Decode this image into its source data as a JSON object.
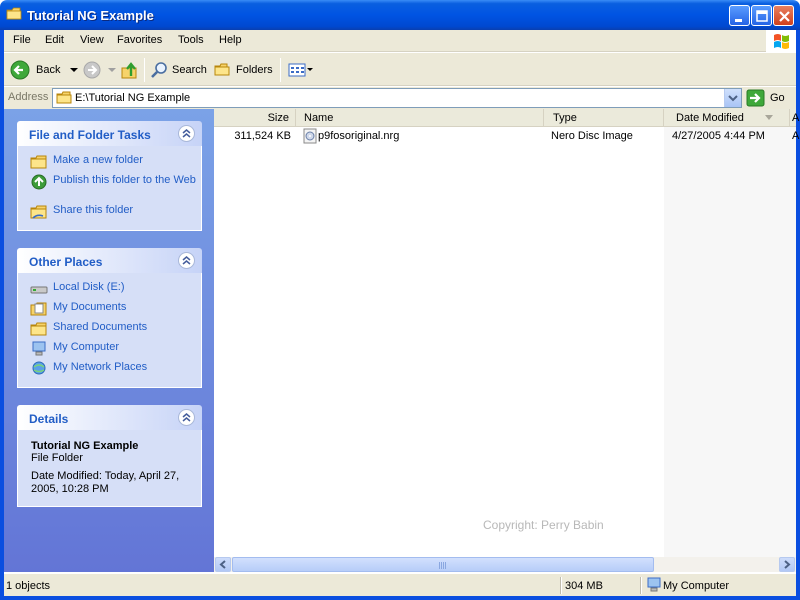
{
  "window": {
    "title": "Tutorial NG Example",
    "accent": "#0054e3"
  },
  "menu": [
    "File",
    "Edit",
    "View",
    "Favorites",
    "Tools",
    "Help"
  ],
  "toolbar": {
    "back": "Back",
    "search": "Search",
    "folders": "Folders"
  },
  "address": {
    "label": "Address",
    "value": "E:\\Tutorial NG Example",
    "go": "Go"
  },
  "tasks_panel": {
    "title": "File and Folder Tasks",
    "items": [
      {
        "label": "Make a new folder",
        "icon": "new-folder-icon"
      },
      {
        "label": "Publish this folder to the Web",
        "icon": "publish-web-icon"
      },
      {
        "label": "Share this folder",
        "icon": "share-folder-icon"
      }
    ]
  },
  "places_panel": {
    "title": "Other Places",
    "items": [
      {
        "label": "Local Disk (E:)",
        "icon": "local-disk-icon"
      },
      {
        "label": "My Documents",
        "icon": "my-documents-icon"
      },
      {
        "label": "Shared Documents",
        "icon": "shared-documents-icon"
      },
      {
        "label": "My Computer",
        "icon": "my-computer-icon"
      },
      {
        "label": "My Network Places",
        "icon": "network-places-icon"
      }
    ]
  },
  "details_panel": {
    "title": "Details",
    "name": "Tutorial NG Example",
    "kind": "File Folder",
    "modified_line1": "Date Modified: Today, April 27,",
    "modified_line2": "2005, 10:28 PM"
  },
  "columns": {
    "size": "Size",
    "name": "Name",
    "type": "Type",
    "date": "Date Modified",
    "extra": "A"
  },
  "files": [
    {
      "size": "311,524 KB",
      "name": "p9fosoriginal.nrg",
      "type": "Nero Disc Image",
      "date": "4/27/2005 4:44 PM",
      "extra": "A"
    }
  ],
  "watermark": "Copyright: Perry Babin",
  "status": {
    "objects": "1 objects",
    "size": "304 MB",
    "location": "My Computer"
  }
}
